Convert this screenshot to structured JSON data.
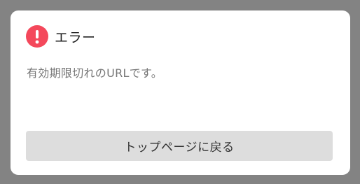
{
  "dialog": {
    "icon": "exclamation-circle-icon",
    "title": "エラー",
    "message": "有効期限切れのURLです。",
    "button_label": "トップページに戻る"
  },
  "colors": {
    "overlay": "#838383",
    "dialog_background": "#ffffff",
    "error_accent": "#f4485b",
    "button_background": "#dddddd",
    "message_text": "#777777"
  }
}
